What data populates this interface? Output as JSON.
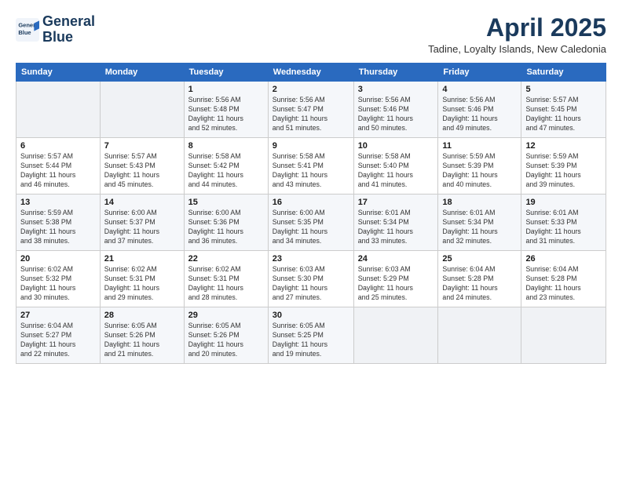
{
  "header": {
    "logo_line1": "General",
    "logo_line2": "Blue",
    "month": "April 2025",
    "location": "Tadine, Loyalty Islands, New Caledonia"
  },
  "weekdays": [
    "Sunday",
    "Monday",
    "Tuesday",
    "Wednesday",
    "Thursday",
    "Friday",
    "Saturday"
  ],
  "weeks": [
    [
      {
        "day": "",
        "info": ""
      },
      {
        "day": "",
        "info": ""
      },
      {
        "day": "1",
        "info": "Sunrise: 5:56 AM\nSunset: 5:48 PM\nDaylight: 11 hours\nand 52 minutes."
      },
      {
        "day": "2",
        "info": "Sunrise: 5:56 AM\nSunset: 5:47 PM\nDaylight: 11 hours\nand 51 minutes."
      },
      {
        "day": "3",
        "info": "Sunrise: 5:56 AM\nSunset: 5:46 PM\nDaylight: 11 hours\nand 50 minutes."
      },
      {
        "day": "4",
        "info": "Sunrise: 5:56 AM\nSunset: 5:46 PM\nDaylight: 11 hours\nand 49 minutes."
      },
      {
        "day": "5",
        "info": "Sunrise: 5:57 AM\nSunset: 5:45 PM\nDaylight: 11 hours\nand 47 minutes."
      }
    ],
    [
      {
        "day": "6",
        "info": "Sunrise: 5:57 AM\nSunset: 5:44 PM\nDaylight: 11 hours\nand 46 minutes."
      },
      {
        "day": "7",
        "info": "Sunrise: 5:57 AM\nSunset: 5:43 PM\nDaylight: 11 hours\nand 45 minutes."
      },
      {
        "day": "8",
        "info": "Sunrise: 5:58 AM\nSunset: 5:42 PM\nDaylight: 11 hours\nand 44 minutes."
      },
      {
        "day": "9",
        "info": "Sunrise: 5:58 AM\nSunset: 5:41 PM\nDaylight: 11 hours\nand 43 minutes."
      },
      {
        "day": "10",
        "info": "Sunrise: 5:58 AM\nSunset: 5:40 PM\nDaylight: 11 hours\nand 41 minutes."
      },
      {
        "day": "11",
        "info": "Sunrise: 5:59 AM\nSunset: 5:39 PM\nDaylight: 11 hours\nand 40 minutes."
      },
      {
        "day": "12",
        "info": "Sunrise: 5:59 AM\nSunset: 5:39 PM\nDaylight: 11 hours\nand 39 minutes."
      }
    ],
    [
      {
        "day": "13",
        "info": "Sunrise: 5:59 AM\nSunset: 5:38 PM\nDaylight: 11 hours\nand 38 minutes."
      },
      {
        "day": "14",
        "info": "Sunrise: 6:00 AM\nSunset: 5:37 PM\nDaylight: 11 hours\nand 37 minutes."
      },
      {
        "day": "15",
        "info": "Sunrise: 6:00 AM\nSunset: 5:36 PM\nDaylight: 11 hours\nand 36 minutes."
      },
      {
        "day": "16",
        "info": "Sunrise: 6:00 AM\nSunset: 5:35 PM\nDaylight: 11 hours\nand 34 minutes."
      },
      {
        "day": "17",
        "info": "Sunrise: 6:01 AM\nSunset: 5:34 PM\nDaylight: 11 hours\nand 33 minutes."
      },
      {
        "day": "18",
        "info": "Sunrise: 6:01 AM\nSunset: 5:34 PM\nDaylight: 11 hours\nand 32 minutes."
      },
      {
        "day": "19",
        "info": "Sunrise: 6:01 AM\nSunset: 5:33 PM\nDaylight: 11 hours\nand 31 minutes."
      }
    ],
    [
      {
        "day": "20",
        "info": "Sunrise: 6:02 AM\nSunset: 5:32 PM\nDaylight: 11 hours\nand 30 minutes."
      },
      {
        "day": "21",
        "info": "Sunrise: 6:02 AM\nSunset: 5:31 PM\nDaylight: 11 hours\nand 29 minutes."
      },
      {
        "day": "22",
        "info": "Sunrise: 6:02 AM\nSunset: 5:31 PM\nDaylight: 11 hours\nand 28 minutes."
      },
      {
        "day": "23",
        "info": "Sunrise: 6:03 AM\nSunset: 5:30 PM\nDaylight: 11 hours\nand 27 minutes."
      },
      {
        "day": "24",
        "info": "Sunrise: 6:03 AM\nSunset: 5:29 PM\nDaylight: 11 hours\nand 25 minutes."
      },
      {
        "day": "25",
        "info": "Sunrise: 6:04 AM\nSunset: 5:28 PM\nDaylight: 11 hours\nand 24 minutes."
      },
      {
        "day": "26",
        "info": "Sunrise: 6:04 AM\nSunset: 5:28 PM\nDaylight: 11 hours\nand 23 minutes."
      }
    ],
    [
      {
        "day": "27",
        "info": "Sunrise: 6:04 AM\nSunset: 5:27 PM\nDaylight: 11 hours\nand 22 minutes."
      },
      {
        "day": "28",
        "info": "Sunrise: 6:05 AM\nSunset: 5:26 PM\nDaylight: 11 hours\nand 21 minutes."
      },
      {
        "day": "29",
        "info": "Sunrise: 6:05 AM\nSunset: 5:26 PM\nDaylight: 11 hours\nand 20 minutes."
      },
      {
        "day": "30",
        "info": "Sunrise: 6:05 AM\nSunset: 5:25 PM\nDaylight: 11 hours\nand 19 minutes."
      },
      {
        "day": "",
        "info": ""
      },
      {
        "day": "",
        "info": ""
      },
      {
        "day": "",
        "info": ""
      }
    ]
  ]
}
